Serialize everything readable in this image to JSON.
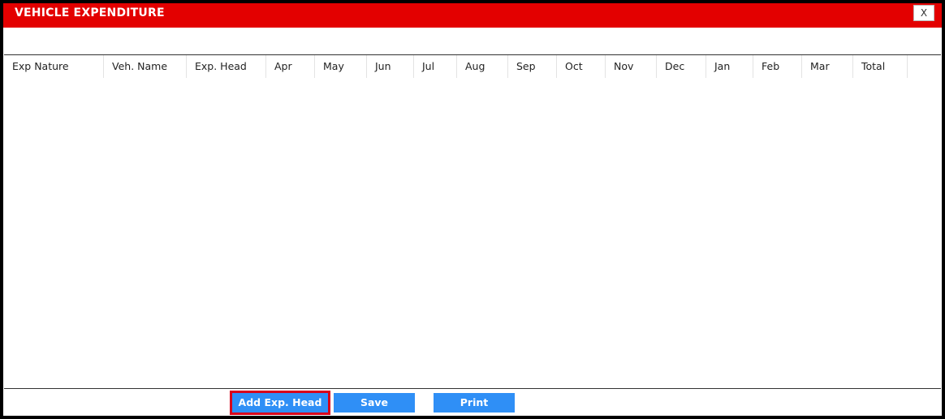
{
  "window": {
    "title": "VEHICLE EXPENDITURE",
    "close_label": "X"
  },
  "table": {
    "columns": [
      "Exp Nature",
      "Veh. Name",
      "Exp. Head",
      "Apr",
      "May",
      "Jun",
      "Jul",
      "Aug",
      "Sep",
      "Oct",
      "Nov",
      "Dec",
      "Jan",
      "Feb",
      "Mar",
      "Total"
    ],
    "rows": []
  },
  "footer": {
    "add_label": "Add Exp. Head",
    "save_label": "Save",
    "print_label": "Print"
  },
  "colors": {
    "title_bar": "#e30000",
    "button": "#2f8ff6",
    "highlight": "#d9001b"
  }
}
